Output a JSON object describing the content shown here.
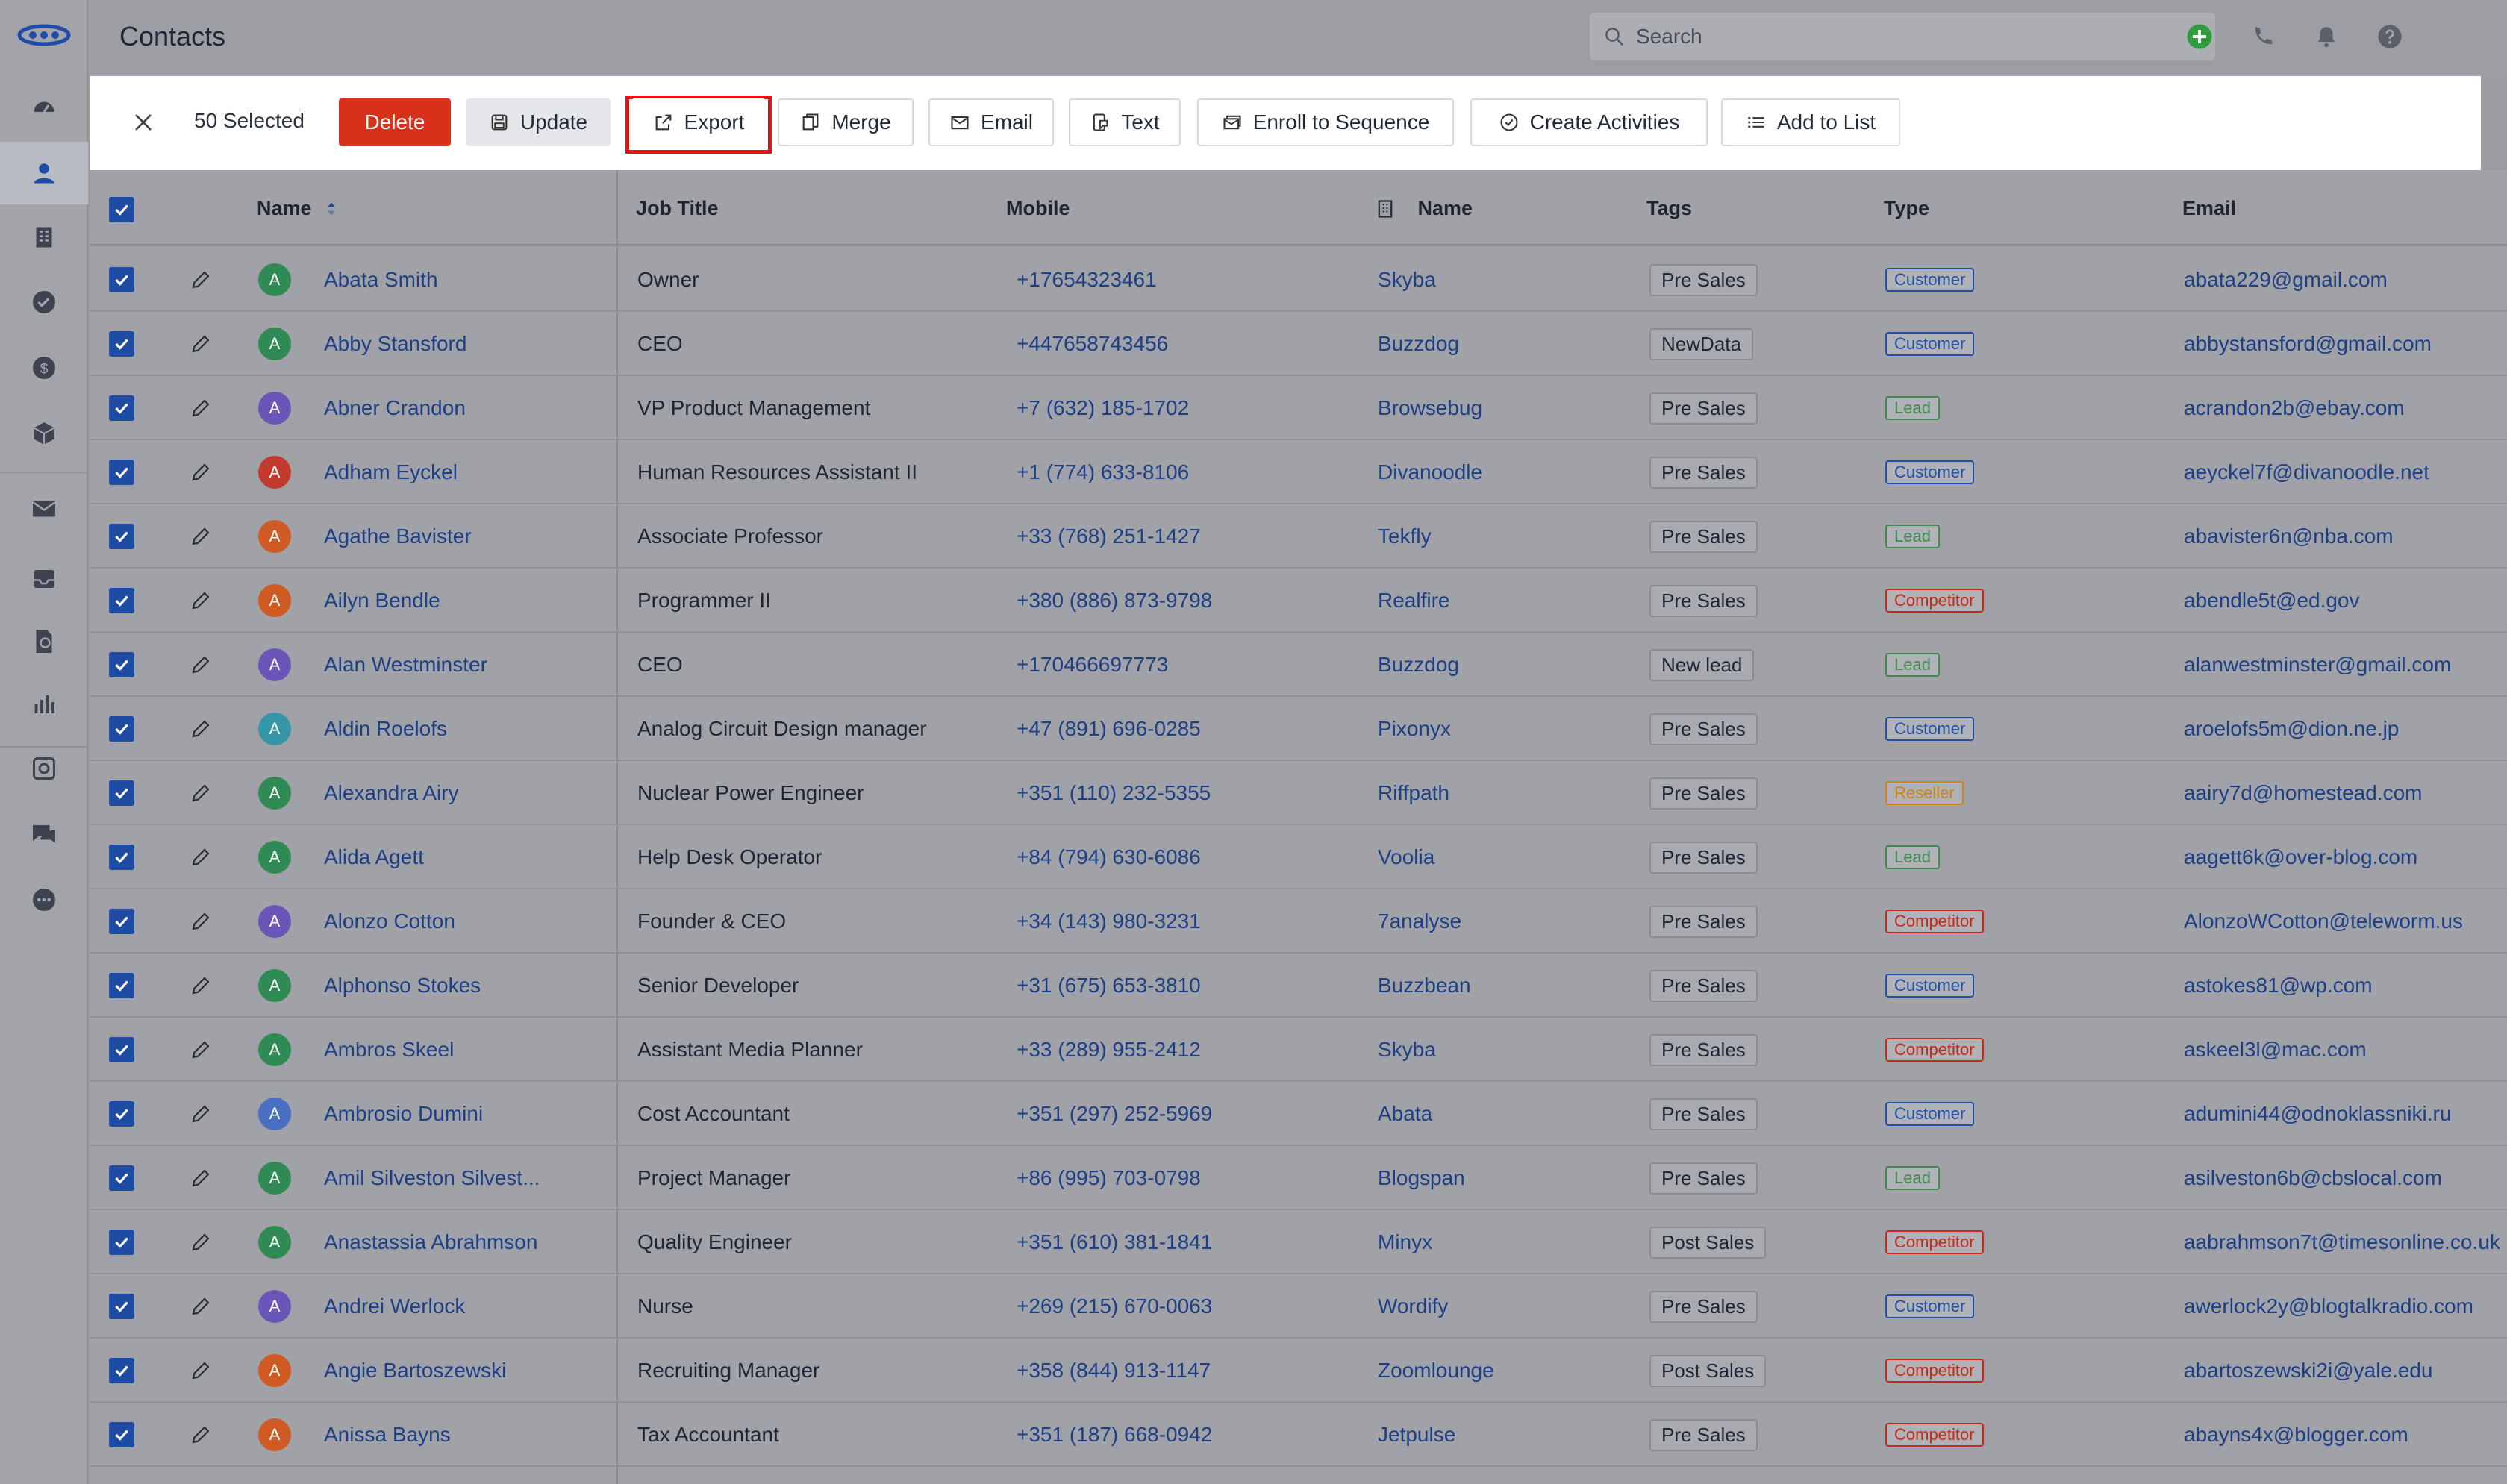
{
  "app": {
    "title": "Contacts"
  },
  "search": {
    "placeholder": "Search"
  },
  "rail": {
    "items": [
      {
        "name": "dashboard-icon"
      },
      {
        "name": "contacts-icon",
        "active": true
      },
      {
        "name": "company-icon"
      },
      {
        "name": "tasks-icon"
      },
      {
        "name": "deals-icon"
      },
      {
        "name": "products-icon"
      },
      {
        "name": "mail-icon"
      },
      {
        "name": "inbox-icon"
      },
      {
        "name": "documents-icon"
      },
      {
        "name": "reports-icon"
      },
      {
        "name": "automation-icon"
      },
      {
        "name": "chat-icon"
      },
      {
        "name": "more-icon"
      }
    ]
  },
  "toolbar": {
    "selected": "50 Selected",
    "delete": "Delete",
    "update": "Update",
    "export": "Export",
    "merge": "Merge",
    "email": "Email",
    "text": "Text",
    "enroll": "Enroll to Sequence",
    "activities": "Create Activities",
    "add_list": "Add to List"
  },
  "columns": {
    "name": "Name",
    "job_title": "Job Title",
    "mobile": "Mobile",
    "company_name": "Name",
    "tags": "Tags",
    "type": "Type",
    "email": "Email"
  },
  "colors": {
    "avatar": {
      "green": "#2f8a55",
      "purple": "#6a56b8",
      "red": "#c23a2e",
      "orange": "#cf5a24",
      "teal": "#3596a8",
      "blue": "#4a6fc0"
    },
    "type": {
      "Customer": "#1f4fa8",
      "Lead": "#3d8a4c",
      "Competitor": "#c42a18",
      "Reseller": "#d18413"
    }
  },
  "rows": [
    {
      "initial": "A",
      "avatar": "green",
      "name": "Abata Smith",
      "job": "Owner",
      "mobile": "+17654323461",
      "company": "Skyba",
      "tag": "Pre Sales",
      "type": "Customer",
      "email": "abata229@gmail.com"
    },
    {
      "initial": "A",
      "avatar": "green",
      "name": "Abby Stansford",
      "job": "CEO",
      "mobile": "+447658743456",
      "company": "Buzzdog",
      "tag": "NewData",
      "type": "Customer",
      "email": "abbystansford@gmail.com"
    },
    {
      "initial": "A",
      "avatar": "purple",
      "name": "Abner Crandon",
      "job": "VP Product Management",
      "mobile": "+7 (632) 185-1702",
      "company": "Browsebug",
      "tag": "Pre Sales",
      "type": "Lead",
      "email": "acrandon2b@ebay.com"
    },
    {
      "initial": "A",
      "avatar": "red",
      "name": "Adham Eyckel",
      "job": "Human Resources Assistant II",
      "mobile": "+1 (774) 633-8106",
      "company": "Divanoodle",
      "tag": "Pre Sales",
      "type": "Customer",
      "email": "aeyckel7f@divanoodle.net"
    },
    {
      "initial": "A",
      "avatar": "orange",
      "name": "Agathe Bavister",
      "job": "Associate Professor",
      "mobile": "+33 (768) 251-1427",
      "company": "Tekfly",
      "tag": "Pre Sales",
      "type": "Lead",
      "email": "abavister6n@nba.com"
    },
    {
      "initial": "A",
      "avatar": "orange",
      "name": "Ailyn Bendle",
      "job": "Programmer II",
      "mobile": "+380 (886) 873-9798",
      "company": "Realfire",
      "tag": "Pre Sales",
      "type": "Competitor",
      "email": "abendle5t@ed.gov"
    },
    {
      "initial": "A",
      "avatar": "purple",
      "name": "Alan Westminster",
      "job": "CEO",
      "mobile": "+170466697773",
      "company": "Buzzdog",
      "tag": "New lead",
      "type": "Lead",
      "email": "alanwestminster@gmail.com"
    },
    {
      "initial": "A",
      "avatar": "teal",
      "name": "Aldin Roelofs",
      "job": "Analog Circuit Design manager",
      "mobile": "+47 (891) 696-0285",
      "company": "Pixonyx",
      "tag": "Pre Sales",
      "type": "Customer",
      "email": "aroelofs5m@dion.ne.jp"
    },
    {
      "initial": "A",
      "avatar": "green",
      "name": "Alexandra Airy",
      "job": "Nuclear Power Engineer",
      "mobile": "+351 (110) 232-5355",
      "company": "Riffpath",
      "tag": "Pre Sales",
      "type": "Reseller",
      "email": "aairy7d@homestead.com"
    },
    {
      "initial": "A",
      "avatar": "green",
      "name": "Alida Agett",
      "job": "Help Desk Operator",
      "mobile": "+84 (794) 630-6086",
      "company": "Voolia",
      "tag": "Pre Sales",
      "type": "Lead",
      "email": "aagett6k@over-blog.com"
    },
    {
      "initial": "A",
      "avatar": "purple",
      "name": "Alonzo Cotton",
      "job": "Founder & CEO",
      "mobile": "+34 (143) 980-3231",
      "company": "7analyse",
      "tag": "Pre Sales",
      "type": "Competitor",
      "email": "AlonzoWCotton@teleworm.us"
    },
    {
      "initial": "A",
      "avatar": "green",
      "name": "Alphonso Stokes",
      "job": "Senior Developer",
      "mobile": "+31 (675) 653-3810",
      "company": "Buzzbean",
      "tag": "Pre Sales",
      "type": "Customer",
      "email": "astokes81@wp.com"
    },
    {
      "initial": "A",
      "avatar": "green",
      "name": "Ambros Skeel",
      "job": "Assistant Media Planner",
      "mobile": "+33 (289) 955-2412",
      "company": "Skyba",
      "tag": "Pre Sales",
      "type": "Competitor",
      "email": "askeel3l@mac.com"
    },
    {
      "initial": "A",
      "avatar": "blue",
      "name": "Ambrosio Dumini",
      "job": "Cost Accountant",
      "mobile": "+351 (297) 252-5969",
      "company": "Abata",
      "tag": "Pre Sales",
      "type": "Customer",
      "email": "adumini44@odnoklassniki.ru"
    },
    {
      "initial": "A",
      "avatar": "green",
      "name": "Amil Silveston Silvest...",
      "job": "Project Manager",
      "mobile": "+86 (995) 703-0798",
      "company": "Blogspan",
      "tag": "Pre Sales",
      "type": "Lead",
      "email": "asilveston6b@cbslocal.com"
    },
    {
      "initial": "A",
      "avatar": "green",
      "name": "Anastassia Abrahmson",
      "job": "Quality Engineer",
      "mobile": "+351 (610) 381-1841",
      "company": "Minyx",
      "tag": "Post Sales",
      "type": "Competitor",
      "email": "aabrahmson7t@timesonline.co.uk"
    },
    {
      "initial": "A",
      "avatar": "purple",
      "name": "Andrei Werlock",
      "job": "Nurse",
      "mobile": "+269 (215) 670-0063",
      "company": "Wordify",
      "tag": "Pre Sales",
      "type": "Customer",
      "email": "awerlock2y@blogtalkradio.com"
    },
    {
      "initial": "A",
      "avatar": "orange",
      "name": "Angie Bartoszewski",
      "job": "Recruiting Manager",
      "mobile": "+358 (844) 913-1147",
      "company": "Zoomlounge",
      "tag": "Post Sales",
      "type": "Competitor",
      "email": "abartoszewski2i@yale.edu"
    },
    {
      "initial": "A",
      "avatar": "orange",
      "name": "Anissa Bayns",
      "job": "Tax Accountant",
      "mobile": "+351 (187) 668-0942",
      "company": "Jetpulse",
      "tag": "Pre Sales",
      "type": "Competitor",
      "email": "abayns4x@blogger.com"
    }
  ]
}
